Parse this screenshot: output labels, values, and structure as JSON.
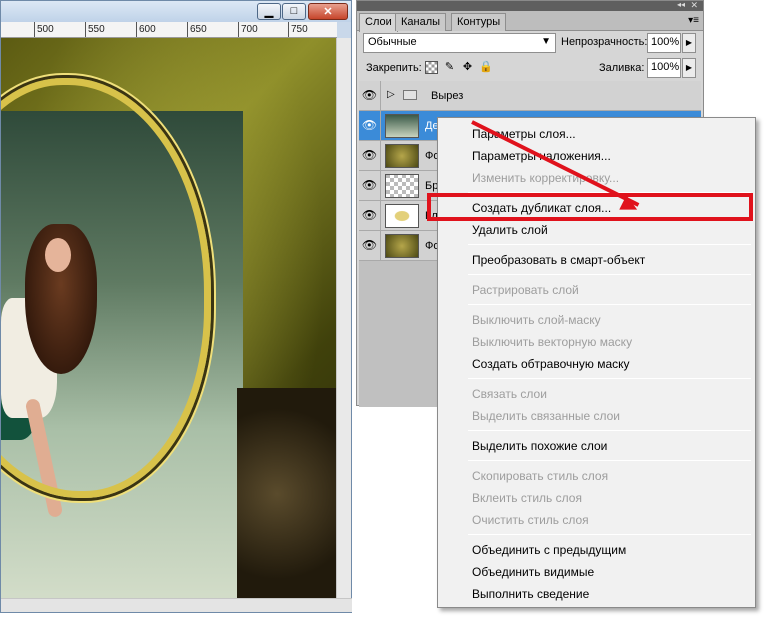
{
  "document": {
    "ruler_ticks": [
      "500",
      "550",
      "600",
      "650",
      "700",
      "750"
    ],
    "window_buttons": {
      "minimize": "▁",
      "maximize": "□",
      "close": "✕"
    }
  },
  "layers_panel": {
    "tabs": [
      "Слои",
      "Каналы",
      "Контуры"
    ],
    "blend_mode": "Обычные",
    "opacity_label": "Непрозрачность:",
    "opacity_value": "100%",
    "lock_label": "Закрепить:",
    "fill_label": "Заливка:",
    "fill_value": "100%",
    "group_name": "Вырез",
    "layers": [
      {
        "name": "Девушка",
        "thumb": "t-photo",
        "selected": true
      },
      {
        "name": "Фо",
        "thumb": "t-olive",
        "selected": false
      },
      {
        "name": "Бр",
        "thumb": "t-checker",
        "selected": false
      },
      {
        "name": "Кл",
        "thumb": "t-frame",
        "selected": false
      },
      {
        "name": "Фо",
        "thumb": "t-olive",
        "selected": false
      }
    ]
  },
  "context_menu": {
    "items": [
      {
        "label": "Параметры слоя...",
        "enabled": true
      },
      {
        "label": "Параметры наложения...",
        "enabled": true
      },
      {
        "label": "Изменить корректировку...",
        "enabled": false
      },
      {
        "label": "Создать дубликат слоя...",
        "enabled": true,
        "highlighted": true
      },
      {
        "label": "Удалить слой",
        "enabled": true
      },
      {
        "label": "Преобразовать в смарт-объект",
        "enabled": true
      },
      {
        "label": "Растрировать слой",
        "enabled": false
      },
      {
        "label": "Выключить слой-маску",
        "enabled": false
      },
      {
        "label": "Выключить векторную маску",
        "enabled": false
      },
      {
        "label": "Создать обтравочную маску",
        "enabled": true
      },
      {
        "label": "Связать слои",
        "enabled": false
      },
      {
        "label": "Выделить связанные слои",
        "enabled": false
      },
      {
        "label": "Выделить похожие слои",
        "enabled": true
      },
      {
        "label": "Скопировать стиль слоя",
        "enabled": false
      },
      {
        "label": "Вклеить стиль слоя",
        "enabled": false
      },
      {
        "label": "Очистить стиль слоя",
        "enabled": false
      },
      {
        "label": "Объединить с предыдущим",
        "enabled": true
      },
      {
        "label": "Объединить видимые",
        "enabled": true
      },
      {
        "label": "Выполнить сведение",
        "enabled": true
      }
    ]
  },
  "colors": {
    "annotation_red": "#e0121c",
    "selection_blue": "#3b8bd8"
  }
}
